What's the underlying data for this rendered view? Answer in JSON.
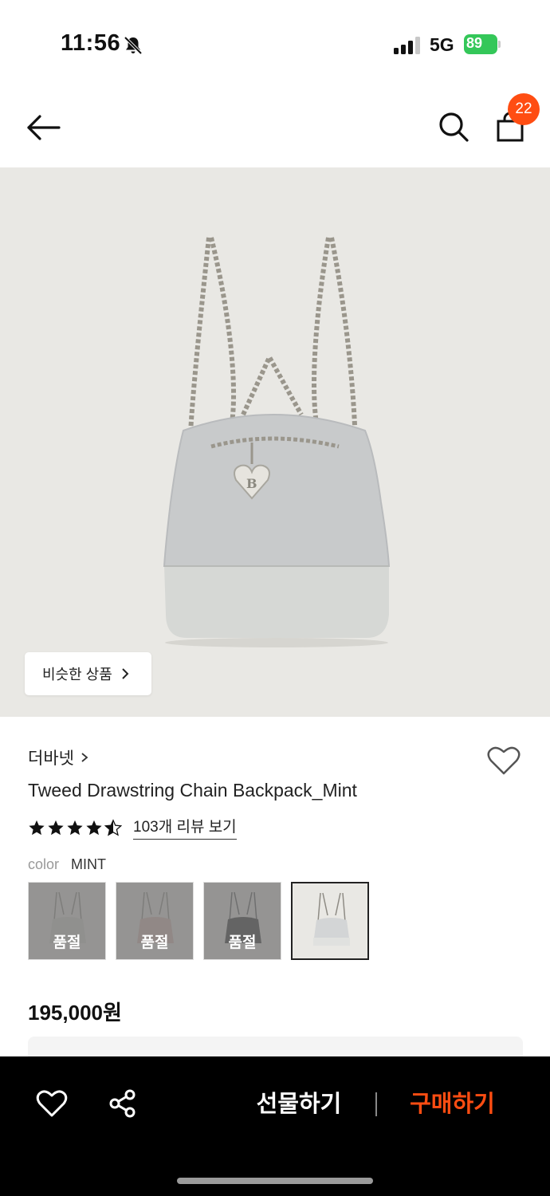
{
  "status_bar": {
    "time": "11:56",
    "network": "5G",
    "battery": "89"
  },
  "nav": {
    "cart_count": "22"
  },
  "image": {
    "similar_label": "비슷한 상품"
  },
  "product": {
    "brand": "더바넷",
    "title": "Tweed Drawstring Chain Backpack_Mint",
    "rating": 4.5,
    "review_label": "103개 리뷰 보기",
    "color_label": "color",
    "color_value": "MINT",
    "price": "195,000원"
  },
  "swatches": [
    {
      "status": "품절",
      "tint": "#d8d6cf"
    },
    {
      "status": "품절",
      "tint": "#d9b7b0"
    },
    {
      "status": "품절",
      "tint": "#2a2a2a"
    },
    {
      "status": "",
      "tint": "#d3d5d6"
    }
  ],
  "bottom_bar": {
    "gift_label": "선물하기",
    "buy_label": "구매하기"
  },
  "colors": {
    "accent": "#ff4d12",
    "battery": "#34c759",
    "bottom_bar": "#000000"
  }
}
